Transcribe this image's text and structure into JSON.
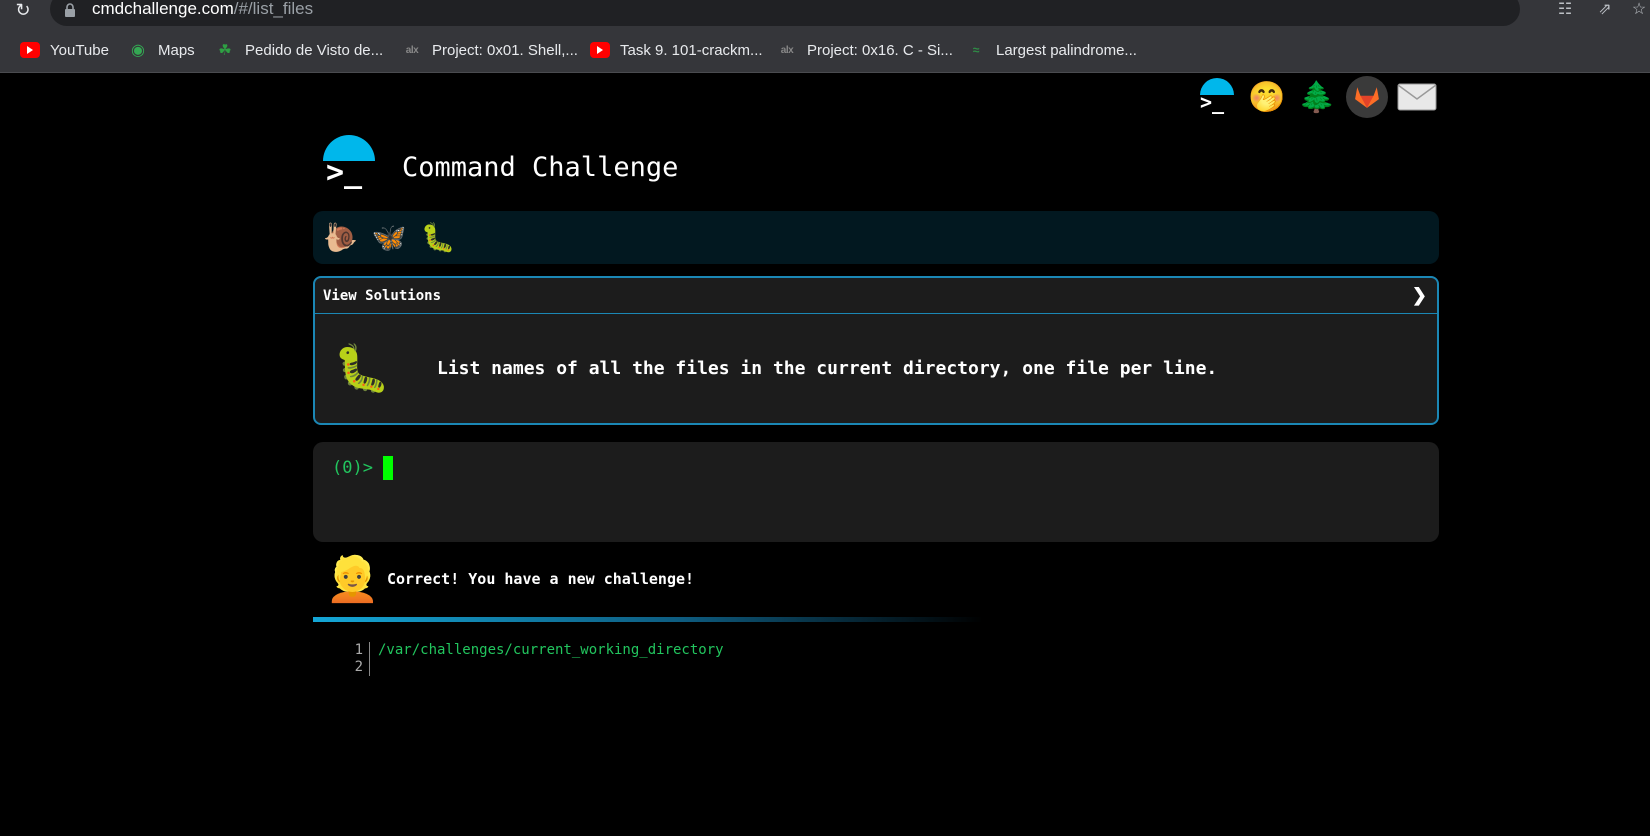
{
  "browser": {
    "url_host": "cmdchallenge.com",
    "url_path": "/#/list_files",
    "icons": [
      "reload-icon",
      "lock-icon",
      "translate-icon",
      "share-icon",
      "star-icon"
    ]
  },
  "bookmarks": [
    {
      "label": "YouTube",
      "icon": "youtube-icon"
    },
    {
      "label": "Maps",
      "icon": "maps-icon"
    },
    {
      "label": "Pedido de Visto de...",
      "icon": "leaf-icon"
    },
    {
      "label": "Project: 0x01. Shell,...",
      "icon": "alx-icon"
    },
    {
      "label": "Task 9. 101-crackm...",
      "icon": "youtube-icon"
    },
    {
      "label": "Project: 0x16. C - Si...",
      "icon": "alx-icon"
    },
    {
      "label": "Largest palindrome...",
      "icon": "gfg-icon"
    }
  ],
  "header": {
    "title": "Command Challenge",
    "nav_icons": [
      "cmd-logo-icon",
      "face-hand-over-mouth-icon",
      "tree-icon",
      "gitlab-icon",
      "mail-icon"
    ]
  },
  "levels": {
    "icons": [
      "snail-icon",
      "moth-icon",
      "caterpillar-icon"
    ]
  },
  "challenge": {
    "header_label": "View Solutions",
    "chevron": "❯",
    "description": "List names of all the files in the current directory, one file per line."
  },
  "terminal": {
    "prompt": "(0)>"
  },
  "feedback": {
    "message": "Correct! You have a new challenge!"
  },
  "output": {
    "lines": [
      {
        "num": "1",
        "text": "/var/challenges/current_working_directory"
      },
      {
        "num": "2",
        "text": ""
      }
    ]
  },
  "colors": {
    "accent": "#00b7eb",
    "prompt_green": "#22c55e",
    "cursor_green": "#00ff00",
    "panel_border": "#1b87b5"
  }
}
